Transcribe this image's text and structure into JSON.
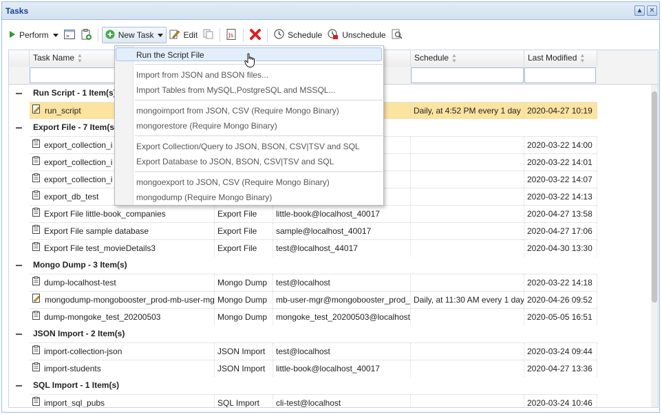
{
  "window": {
    "title": "Tasks"
  },
  "toolbar": {
    "perform": "Perform",
    "new_task": "New Task",
    "edit": "Edit",
    "schedule": "Schedule",
    "unschedule": "Unschedule"
  },
  "columns": {
    "task_name": "Task Name",
    "schedule": "Schedule",
    "last_modified": "Last Modified"
  },
  "menu": {
    "items": [
      "Run the Script File",
      "Import from JSON and BSON files...",
      "Import Tables from MySQL,PostgreSQL and MSSQL...",
      "mongoimport from JSON, CSV (Require Mongo Binary)",
      "mongorestore (Require Mongo Binary)",
      "Export Collection/Query to JSON, BSON, CSV|TSV and SQL",
      "Export Database to JSON, BSON, CSV|TSV and SQL",
      "mongoexport to JSON, CSV (Require Mongo Binary)",
      "mongodump (Require Mongo Binary)"
    ]
  },
  "groups": [
    {
      "label": "Run Script - 1 Item(s)",
      "rows": [
        {
          "name": "run_script",
          "type": "",
          "target": "",
          "schedule": "Daily, at 4:52 PM every 1 day",
          "modified": "2020-04-27 10:19",
          "icon": "script-icon",
          "selected": true
        }
      ]
    },
    {
      "label": "Export File - 7 Item(s)",
      "rows": [
        {
          "name": "export_collection_i",
          "type": "",
          "target": "",
          "schedule": "",
          "modified": "2020-03-22 14:00",
          "icon": "clipboard-icon"
        },
        {
          "name": "export_collection_i",
          "type": "",
          "target": "",
          "schedule": "",
          "modified": "2020-03-22 14:01",
          "icon": "clipboard-icon"
        },
        {
          "name": "export_collection_i",
          "type": "",
          "target": "",
          "schedule": "",
          "modified": "2020-03-22 14:07",
          "icon": "clipboard-icon"
        },
        {
          "name": "export_db_test",
          "type": "",
          "target": "",
          "schedule": "",
          "modified": "2020-03-22 14:13",
          "icon": "clipboard-icon"
        },
        {
          "name": "Export File little-book_companies",
          "type": "Export File",
          "target": "little-book@localhost_40017",
          "schedule": "",
          "modified": "2020-04-27 13:58",
          "icon": "clipboard-icon"
        },
        {
          "name": "Export File sample database",
          "type": "Export File",
          "target": "sample@localhost_40017",
          "schedule": "",
          "modified": "2020-04-27 17:06",
          "icon": "clipboard-icon"
        },
        {
          "name": "Export File test_movieDetails3",
          "type": "Export File",
          "target": "test@localhost_44017",
          "schedule": "",
          "modified": "2020-04-30 13:30",
          "icon": "clipboard-icon"
        }
      ]
    },
    {
      "label": "Mongo Dump - 3 Item(s)",
      "rows": [
        {
          "name": "dump-localhost-test",
          "type": "Mongo Dump",
          "target": "test@localhost",
          "schedule": "",
          "modified": "2020-03-22 14:18",
          "icon": "clipboard-icon"
        },
        {
          "name": "mongodump-mongobooster_prod-mb-user-mg",
          "type": "Mongo Dump",
          "target": "mb-user-mgr@mongobooster_prod_",
          "schedule": "Daily, at 11:30 AM every 1 day",
          "modified": "2020-04-26 09:52",
          "icon": "script-icon"
        },
        {
          "name": "dump-mongoke_test_20200503",
          "type": "Mongo Dump",
          "target": "mongoke_test_20200503@localhost",
          "schedule": "",
          "modified": "2020-05-05 16:51",
          "icon": "clipboard-icon"
        }
      ]
    },
    {
      "label": "JSON Import - 2 Item(s)",
      "rows": [
        {
          "name": "import-collection-json",
          "type": "JSON Import",
          "target": "test@localhost",
          "schedule": "",
          "modified": "2020-03-24 09:44",
          "icon": "clipboard-icon"
        },
        {
          "name": "import-students",
          "type": "JSON Import",
          "target": "little-book@localhost_40017",
          "schedule": "",
          "modified": "2020-04-27 13:36",
          "icon": "clipboard-icon"
        }
      ]
    },
    {
      "label": "SQL Import - 1 Item(s)",
      "rows": [
        {
          "name": "import_sql_pubs",
          "type": "SQL Import",
          "target": "cli-test@localhost",
          "schedule": "",
          "modified": "2020-03-24 10:46",
          "icon": "clipboard-icon"
        }
      ]
    }
  ]
}
